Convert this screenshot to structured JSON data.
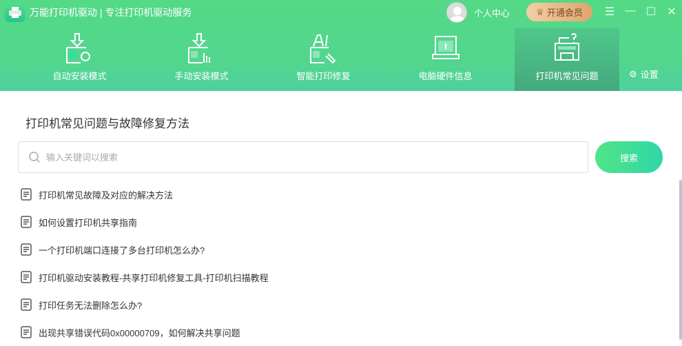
{
  "app": {
    "title": "万能打印机驱动 | 专注打印机驱动服务",
    "user_center": "个人中心",
    "vip": "开通会员"
  },
  "nav": [
    {
      "label": "自动安装模式"
    },
    {
      "label": "手动安装模式"
    },
    {
      "label": "智能打印修复"
    },
    {
      "label": "电脑硬件信息"
    },
    {
      "label": "打印机常见问题"
    }
  ],
  "settings": "设置",
  "main": {
    "heading": "打印机常见问题与故障修复方法",
    "search_placeholder": "输入关键词以搜索",
    "search_button": "搜索",
    "articles": [
      "打印机常见故障及对应的解决方法",
      "如何设置打印机共享指南",
      "一个打印机端口连接了多台打印机怎么办?",
      "打印机驱动安装教程-共享打印机修复工具-打印机扫描教程",
      "打印任务无法删除怎么办?",
      "出现共享错误代码0x00000709，如何解决共享问题"
    ]
  }
}
